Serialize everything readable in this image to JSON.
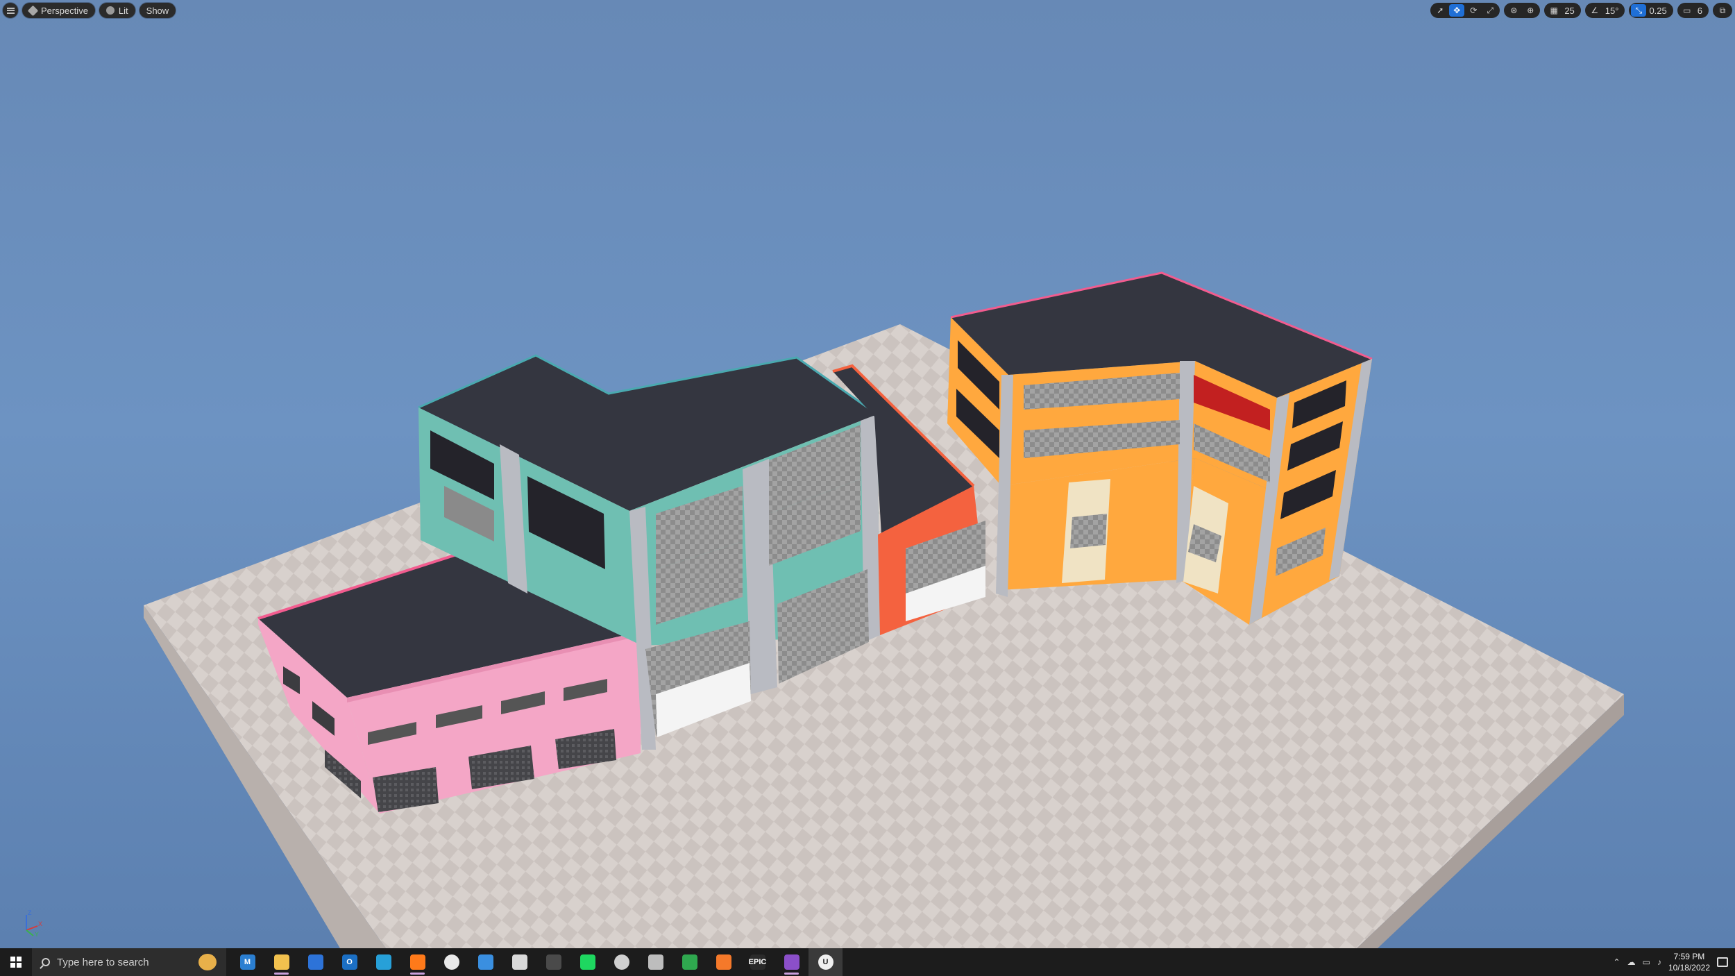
{
  "viewport_toolbar": {
    "view_mode": "Perspective",
    "lighting": "Lit",
    "show": "Show",
    "grid_snap": "25",
    "rotation_snap": "15°",
    "scale_snap": "0.25",
    "camera_speed": "6"
  },
  "scene": {
    "axis_labels": {
      "z": "Z",
      "x": "X",
      "y": "Y"
    },
    "colors": {
      "sky": "#6a8fbe",
      "floor": "#d6cfcb",
      "roof": "#3d3f4a",
      "pink": "#f4a6c6",
      "teal": "#6fbfb2",
      "red_orange": "#f4623f",
      "orange": "#ffa83e",
      "concrete": "#b9bbc2"
    }
  },
  "taskbar": {
    "search_placeholder": "Type here to search",
    "apps": [
      {
        "icon": "mail-m-icon",
        "label": "M",
        "color": "#2b7fd1"
      },
      {
        "icon": "file-explorer-icon",
        "label": "",
        "color": "#f2c14e"
      },
      {
        "icon": "shield-icon",
        "label": "",
        "color": "#2d73d8"
      },
      {
        "icon": "outlook-icon",
        "label": "O",
        "color": "#1b6fc4"
      },
      {
        "icon": "cube-app-icon",
        "label": "",
        "color": "#27a0d8"
      },
      {
        "icon": "firefox-icon",
        "label": "",
        "color": "#ff7a1a"
      },
      {
        "icon": "slack-icon",
        "label": "",
        "color": "#e9e9e9"
      },
      {
        "icon": "photos-icon",
        "label": "",
        "color": "#3a8fe0"
      },
      {
        "icon": "paint-icon",
        "label": "",
        "color": "#d9d9d9"
      },
      {
        "icon": "davinci-icon",
        "label": "",
        "color": "#4a4a4a"
      },
      {
        "icon": "spotify-icon",
        "label": "",
        "color": "#1ed760"
      },
      {
        "icon": "github-icon",
        "label": "",
        "color": "#cfcfcf"
      },
      {
        "icon": "unity-hub-icon",
        "label": "",
        "color": "#bdbdbd"
      },
      {
        "icon": "greenshot-icon",
        "label": "",
        "color": "#2fa84f"
      },
      {
        "icon": "blender-icon",
        "label": "",
        "color": "#f5792a"
      },
      {
        "icon": "epic-games-icon",
        "label": "EPIC",
        "color": "#2a2a2a"
      },
      {
        "icon": "visual-studio-icon",
        "label": "",
        "color": "#8b4fc9"
      },
      {
        "icon": "unreal-engine-icon",
        "label": "U",
        "color": "#f0f0f0"
      }
    ],
    "time": "7:59 PM",
    "date": "10/18/2022"
  }
}
